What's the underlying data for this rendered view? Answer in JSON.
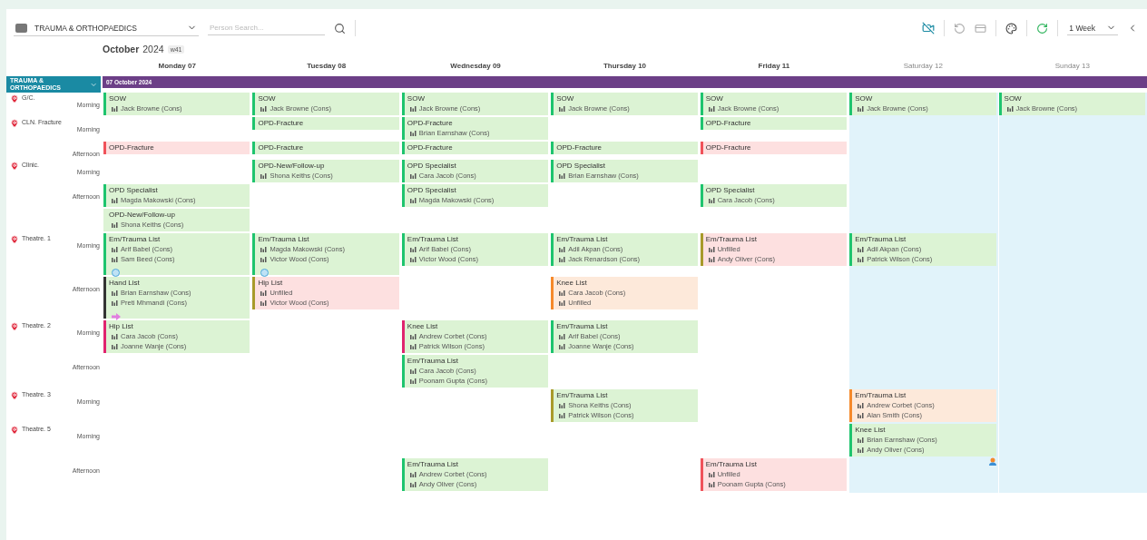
{
  "toolbar": {
    "department": "TRAUMA & ORTHOPAEDICS",
    "search": {
      "placeholder": "Person Search..."
    },
    "range": "1 Week"
  },
  "calendar": {
    "month": "October",
    "year": "2024",
    "week_badge": "w41",
    "group": "TRAUMA & ORTHOPAEDICS",
    "date_banner": "07 October 2024",
    "days": [
      {
        "label": "Monday 07",
        "weekend": false
      },
      {
        "label": "Tuesday 08",
        "weekend": false
      },
      {
        "label": "Wednesday 09",
        "weekend": false
      },
      {
        "label": "Thursday 10",
        "weekend": false
      },
      {
        "label": "Friday 11",
        "weekend": false
      },
      {
        "label": "Saturday 12",
        "weekend": true
      },
      {
        "label": "Sunday 13",
        "weekend": true
      }
    ],
    "rows": [
      {
        "location": "G/C.",
        "session": "Morning",
        "cells": [
          [
            {
              "title": "SOW",
              "color": "#1ec46e",
              "kind": "staffed",
              "people": [
                "Jack Browne (Cons)"
              ]
            }
          ],
          [
            {
              "title": "SOW",
              "color": "#1ec46e",
              "kind": "staffed",
              "people": [
                "Jack Browne (Cons)"
              ]
            }
          ],
          [
            {
              "title": "SOW",
              "color": "#1ec46e",
              "kind": "staffed",
              "people": [
                "Jack Browne (Cons)"
              ]
            }
          ],
          [
            {
              "title": "SOW",
              "color": "#1ec46e",
              "kind": "staffed",
              "people": [
                "Jack Browne (Cons)"
              ]
            }
          ],
          [
            {
              "title": "SOW",
              "color": "#1ec46e",
              "kind": "staffed",
              "people": [
                "Jack Browne (Cons)"
              ]
            }
          ],
          [
            {
              "title": "SOW",
              "color": "#1ec46e",
              "kind": "staffed",
              "people": [
                "Jack Browne (Cons)"
              ]
            }
          ],
          [
            {
              "title": "SOW",
              "color": "#1ec46e",
              "kind": "staffed",
              "people": [
                "Jack Browne (Cons)"
              ]
            }
          ]
        ]
      },
      {
        "location": "CLN. Fracture",
        "session": "Morning",
        "cells": [
          [],
          [
            {
              "title": "OPD-Fracture",
              "color": "#1ec46e",
              "kind": "staffed"
            }
          ],
          [
            {
              "title": "OPD-Fracture",
              "color": "#1ec46e",
              "kind": "staffed",
              "people": [
                "Brian Earnshaw (Cons)"
              ]
            }
          ],
          [],
          [
            {
              "title": "OPD-Fracture",
              "color": "#1ec46e",
              "kind": "staffed"
            }
          ],
          [],
          []
        ]
      },
      {
        "session": "Afternoon",
        "cells": [
          [
            {
              "title": "OPD-Fracture",
              "color": "#f0525a",
              "kind": "unstaffed"
            }
          ],
          [
            {
              "title": "OPD-Fracture",
              "color": "#1ec46e",
              "kind": "staffed"
            }
          ],
          [
            {
              "title": "OPD-Fracture",
              "color": "#1ec46e",
              "kind": "staffed"
            }
          ],
          [
            {
              "title": "OPD-Fracture",
              "color": "#1ec46e",
              "kind": "staffed"
            }
          ],
          [
            {
              "title": "OPD-Fracture",
              "color": "#f0525a",
              "kind": "unstaffed"
            }
          ],
          [],
          []
        ]
      },
      {
        "location": "Clinic.",
        "session": "Morning",
        "cells": [
          [],
          [
            {
              "title": "OPD-New/Follow-up",
              "color": "#1ec46e",
              "kind": "staffed",
              "people": [
                "Shona Keiths (Cons)"
              ]
            }
          ],
          [
            {
              "title": "OPD Specialist",
              "color": "#1ec46e",
              "kind": "staffed",
              "people": [
                "Cara Jacob (Cons)"
              ]
            }
          ],
          [
            {
              "title": "OPD Specialist",
              "color": "#1ec46e",
              "kind": "staffed",
              "people": [
                "Brian Earnshaw (Cons)"
              ]
            }
          ],
          [],
          [],
          []
        ]
      },
      {
        "session": "Afternoon",
        "cells": [
          [
            {
              "title": "OPD Specialist",
              "color": "#1ec46e",
              "kind": "staffed",
              "people": [
                "Magda Makowski (Cons)"
              ]
            },
            {
              "title": "OPD-New/Follow-up",
              "color": "#dcf3d4",
              "kind": "staffed",
              "people": [
                "Shona Keiths (Cons)"
              ]
            }
          ],
          [],
          [
            {
              "title": "OPD Specialist",
              "color": "#1ec46e",
              "kind": "staffed",
              "people": [
                "Magda Makowski (Cons)"
              ]
            }
          ],
          [],
          [
            {
              "title": "OPD Specialist",
              "color": "#1ec46e",
              "kind": "staffed",
              "people": [
                "Cara Jacob (Cons)"
              ]
            }
          ],
          [],
          []
        ]
      },
      {
        "location": "Theatre. 1",
        "session": "Morning",
        "cells": [
          [
            {
              "title": "Em/Trauma List",
              "color": "#1ec46e",
              "kind": "staffed",
              "people": [
                "Arif Babel (Cons)",
                "Sam Beed (Cons)"
              ],
              "marker": {
                "kind": "globe"
              }
            }
          ],
          [
            {
              "title": "Em/Trauma List",
              "color": "#1ec46e",
              "kind": "staffed",
              "people": [
                "Magda Makowski (Cons)",
                "Victor Wood (Cons)"
              ],
              "marker": {
                "kind": "globe"
              }
            }
          ],
          [
            {
              "title": "Em/Trauma List",
              "color": "#1ec46e",
              "kind": "staffed",
              "people": [
                "Arif Babel (Cons)",
                "Victor Wood (Cons)"
              ]
            }
          ],
          [
            {
              "title": "Em/Trauma List",
              "color": "#1ec46e",
              "kind": "staffed",
              "people": [
                "Adil Akpan (Cons)",
                "Jack Renardson (Cons)"
              ]
            }
          ],
          [
            {
              "title": "Em/Trauma List",
              "color": "#a89a2a",
              "kind": "unstaffed",
              "people": [
                "Unfilled",
                "Andy Oliver (Cons)"
              ]
            }
          ],
          [
            {
              "title": "Em/Trauma List",
              "color": "#1ec46e",
              "kind": "staffed",
              "people": [
                "Adil Akpan (Cons)",
                "Patrick Wilson (Cons)"
              ]
            }
          ],
          []
        ]
      },
      {
        "session": "Afternoon",
        "cells": [
          [
            {
              "title": "Hand List",
              "color": "#333333",
              "kind": "staffed",
              "people": [
                "Brian Earnshaw (Cons)",
                "Preti Mhmandi (Cons)"
              ],
              "marker": {
                "kind": "arrow"
              }
            }
          ],
          [
            {
              "title": "Hip List",
              "color": "#a89a2a",
              "kind": "unstaffed",
              "people": [
                "Unfilled",
                "Victor Wood (Cons)"
              ]
            }
          ],
          [],
          [
            {
              "title": "Knee List",
              "color": "#f5892a",
              "kind": "pending",
              "people": [
                "Cara Jacob (Cons)",
                "Unfilled"
              ]
            }
          ],
          [],
          [],
          []
        ]
      },
      {
        "location": "Theatre. 2",
        "session": "Morning",
        "cells": [
          [
            {
              "title": "Hip List",
              "color": "#e0246f",
              "kind": "staffed",
              "people": [
                "Cara Jacob (Cons)",
                "Joanne Wanje (Cons)"
              ]
            }
          ],
          [],
          [
            {
              "title": "Knee List",
              "color": "#e0246f",
              "kind": "staffed",
              "people": [
                "Andrew Corbet (Cons)",
                "Patrick Wilson (Cons)"
              ]
            }
          ],
          [
            {
              "title": "Em/Trauma List",
              "color": "#1ec46e",
              "kind": "staffed",
              "people": [
                "Arif Babel (Cons)",
                "Joanne Wanje (Cons)"
              ]
            }
          ],
          [],
          [],
          []
        ]
      },
      {
        "session": "Afternoon",
        "cells": [
          [],
          [],
          [
            {
              "title": "Em/Trauma List",
              "color": "#1ec46e",
              "kind": "staffed",
              "people": [
                "Cara Jacob (Cons)",
                "Poonam Gupta (Cons)"
              ]
            }
          ],
          [],
          [],
          [],
          []
        ]
      },
      {
        "location": "Theatre. 3",
        "session": "Morning",
        "cells": [
          [],
          [],
          [],
          [
            {
              "title": "Em/Trauma List",
              "color": "#a89a2a",
              "kind": "staffed",
              "people": [
                "Shona Keiths (Cons)",
                "Patrick Wilson (Cons)"
              ]
            }
          ],
          [],
          [
            {
              "title": "Em/Trauma List",
              "color": "#f5892a",
              "kind": "pending",
              "people": [
                "Andrew Corbet (Cons)",
                "Alan Smith (Cons)"
              ]
            }
          ],
          []
        ]
      },
      {
        "location": "Theatre. 5",
        "session": "Morning",
        "cells": [
          [],
          [],
          [],
          [],
          [],
          [
            {
              "title": "Knee List",
              "color": "#1ec46e",
              "kind": "staffed",
              "people": [
                "Brian Earnshaw (Cons)",
                "Andy Oliver (Cons)"
              ],
              "marker": {
                "kind": "person"
              }
            }
          ],
          []
        ]
      },
      {
        "session": "Afternoon",
        "cells": [
          [],
          [],
          [
            {
              "title": "Em/Trauma List",
              "color": "#1ec46e",
              "kind": "staffed",
              "people": [
                "Andrew Corbet (Cons)",
                "Andy Oliver (Cons)"
              ]
            }
          ],
          [],
          [
            {
              "title": "Em/Trauma List",
              "color": "#f0525a",
              "kind": "unstaffed",
              "people": [
                "Unfilled",
                "Poonam Gupta (Cons)"
              ]
            }
          ],
          [],
          []
        ]
      }
    ]
  }
}
